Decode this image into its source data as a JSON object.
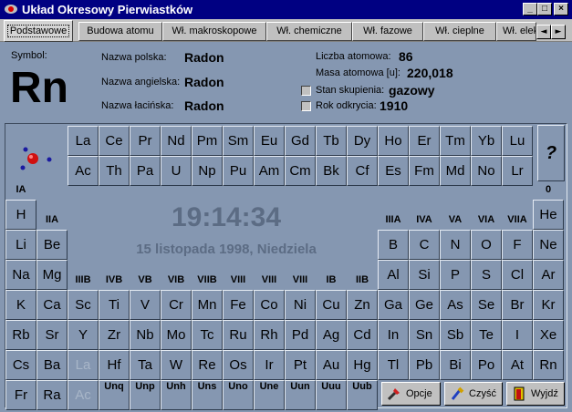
{
  "window": {
    "title": "Układ Okresowy Pierwiastków",
    "minimize": "_",
    "maximize": "□",
    "close": "×"
  },
  "tabs": [
    "Podstawowe",
    "Budowa atomu",
    "Wł. makroskopowe",
    "Wł. chemiczne",
    "Wł. fazowe",
    "Wł. cieplne",
    "Wł. elektryczne"
  ],
  "tab_scroll": {
    "left": "◄",
    "right": "►"
  },
  "element": {
    "symbol_label": "Symbol:",
    "symbol": "Rn",
    "pl_label": "Nazwa polska:",
    "pl": "Radon",
    "en_label": "Nazwa angielska:",
    "en": "Radon",
    "la_label": "Nazwa łacińska:",
    "la": "Radon",
    "z_label": "Liczba atomowa:",
    "z": "86",
    "mass_label": "Masa atomowa [u]:",
    "mass": "220,018",
    "state_label": "Stan skupienia:",
    "state": "gazowy",
    "year_label": "Rok odkrycia:",
    "year": "1910"
  },
  "clock": {
    "time": "19:14:34",
    "date": "15 listopada 1998, Niedziela"
  },
  "help": "?",
  "groups": [
    "IA",
    "IIA",
    "IIIB",
    "IVB",
    "VB",
    "VIB",
    "VIIB",
    "VIII",
    "VIII",
    "VIII",
    "IB",
    "IIB",
    "IIIA",
    "IVA",
    "VA",
    "VIA",
    "VIIA",
    "0"
  ],
  "main_table": [
    [
      "H",
      "",
      "",
      "",
      "",
      "",
      "",
      "",
      "",
      "",
      "",
      "",
      "",
      "",
      "",
      "",
      "",
      "He"
    ],
    [
      "Li",
      "Be",
      "",
      "",
      "",
      "",
      "",
      "",
      "",
      "",
      "",
      "",
      "B",
      "C",
      "N",
      "O",
      "F",
      "Ne"
    ],
    [
      "Na",
      "Mg",
      "",
      "",
      "",
      "",
      "",
      "",
      "",
      "",
      "",
      "",
      "Al",
      "Si",
      "P",
      "S",
      "Cl",
      "Ar"
    ],
    [
      "K",
      "Ca",
      "Sc",
      "Ti",
      "V",
      "Cr",
      "Mn",
      "Fe",
      "Co",
      "Ni",
      "Cu",
      "Zn",
      "Ga",
      "Ge",
      "As",
      "Se",
      "Br",
      "Kr"
    ],
    [
      "Rb",
      "Sr",
      "Y",
      "Zr",
      "Nb",
      "Mo",
      "Tc",
      "Ru",
      "Rh",
      "Pd",
      "Ag",
      "Cd",
      "In",
      "Sn",
      "Sb",
      "Te",
      "I",
      "Xe"
    ],
    [
      "Cs",
      "Ba",
      "La",
      "Hf",
      "Ta",
      "W",
      "Re",
      "Os",
      "Ir",
      "Pt",
      "Au",
      "Hg",
      "Tl",
      "Pb",
      "Bi",
      "Po",
      "At",
      "Rn"
    ],
    [
      "Fr",
      "Ra",
      "Ac",
      "Unq",
      "Unp",
      "Unh",
      "Uns",
      "Uno",
      "Une",
      "Uun",
      "Uuu",
      "Uub",
      "",
      "",
      "",
      "",
      "",
      ""
    ]
  ],
  "lanthanides": [
    "La",
    "Ce",
    "Pr",
    "Nd",
    "Pm",
    "Sm",
    "Eu",
    "Gd",
    "Tb",
    "Dy",
    "Ho",
    "Er",
    "Tm",
    "Yb",
    "Lu"
  ],
  "actinides": [
    "Ac",
    "Th",
    "Pa",
    "U",
    "Np",
    "Pu",
    "Am",
    "Cm",
    "Bk",
    "Cf",
    "Es",
    "Fm",
    "Md",
    "No",
    "Lr"
  ],
  "actions": {
    "options": "Opcje",
    "clear": "Czyść",
    "exit": "Wyjdź"
  },
  "colors": {
    "background": "#8597b1",
    "titlebar": "#000082",
    "clock": "#5c6c84"
  }
}
